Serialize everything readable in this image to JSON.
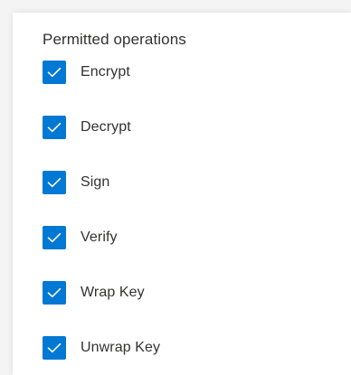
{
  "section": {
    "title": "Permitted operations"
  },
  "operations": [
    {
      "label": "Encrypt",
      "checked": true
    },
    {
      "label": "Decrypt",
      "checked": true
    },
    {
      "label": "Sign",
      "checked": true
    },
    {
      "label": "Verify",
      "checked": true
    },
    {
      "label": "Wrap Key",
      "checked": true
    },
    {
      "label": "Unwrap Key",
      "checked": true
    }
  ],
  "colors": {
    "accent": "#0078d4",
    "text": "#323130"
  },
  "icons": {
    "checkbox": "checkmark-icon"
  }
}
